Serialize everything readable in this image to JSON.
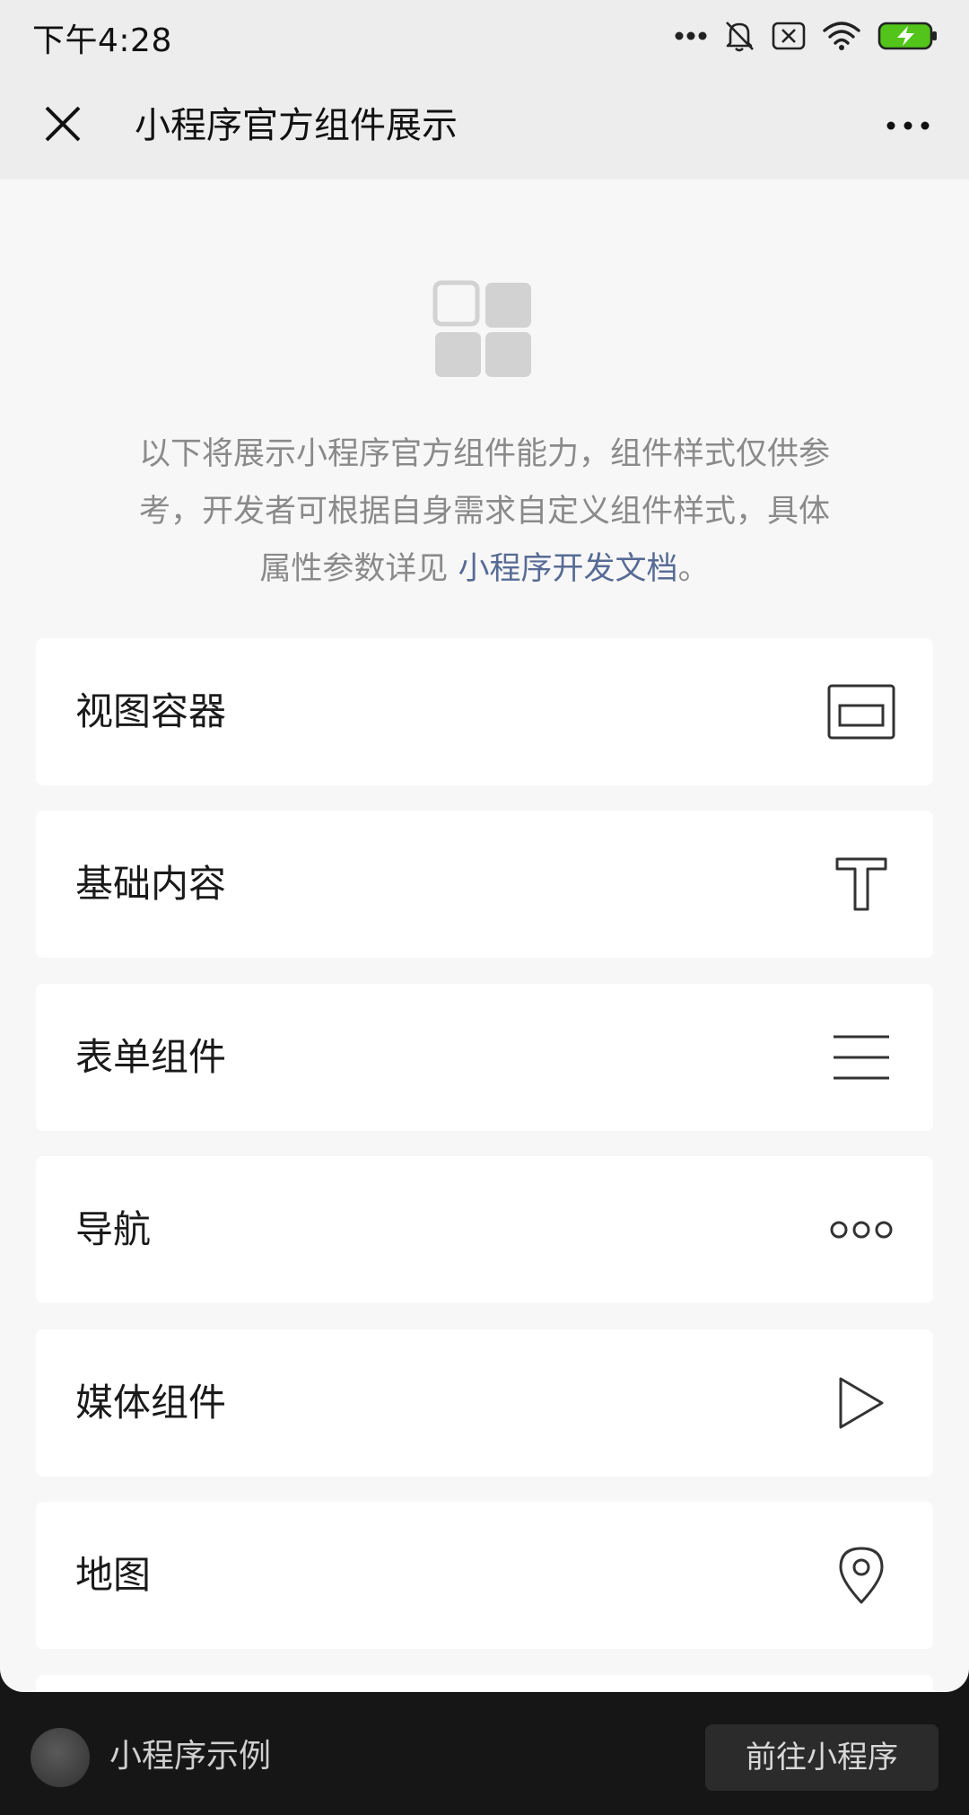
{
  "status_bar": {
    "time": "下午4:28",
    "icons": [
      "more-dots-icon",
      "bell-muted-icon",
      "sim-off-icon",
      "wifi-icon",
      "battery-charging-icon"
    ],
    "battery_color": "#52c41a"
  },
  "nav_bar": {
    "title": "小程序官方组件展示",
    "close_icon": "close-icon",
    "more_icon": "more-icon"
  },
  "intro": {
    "logo_icon": "component-grid-icon",
    "line1": "以下将展示小程序官方组件能力，组件样式仅供参",
    "line2": "考，开发者可根据自身需求自定义组件样式，具体",
    "line3_prefix": "属性参数详见 ",
    "link_text": "小程序开发文档",
    "line3_suffix": "。",
    "link_color": "#576b95"
  },
  "list": {
    "items": [
      {
        "label": "视图容器",
        "icon": "view-container-icon"
      },
      {
        "label": "基础内容",
        "icon": "text-t-icon"
      },
      {
        "label": "表单组件",
        "icon": "form-lines-icon"
      },
      {
        "label": "导航",
        "icon": "navigation-dots-icon"
      },
      {
        "label": "媒体组件",
        "icon": "play-icon"
      },
      {
        "label": "地图",
        "icon": "map-pin-icon"
      }
    ]
  },
  "bottom_bar": {
    "app_name": "小程序示例",
    "enter_button": "前往小程序"
  }
}
